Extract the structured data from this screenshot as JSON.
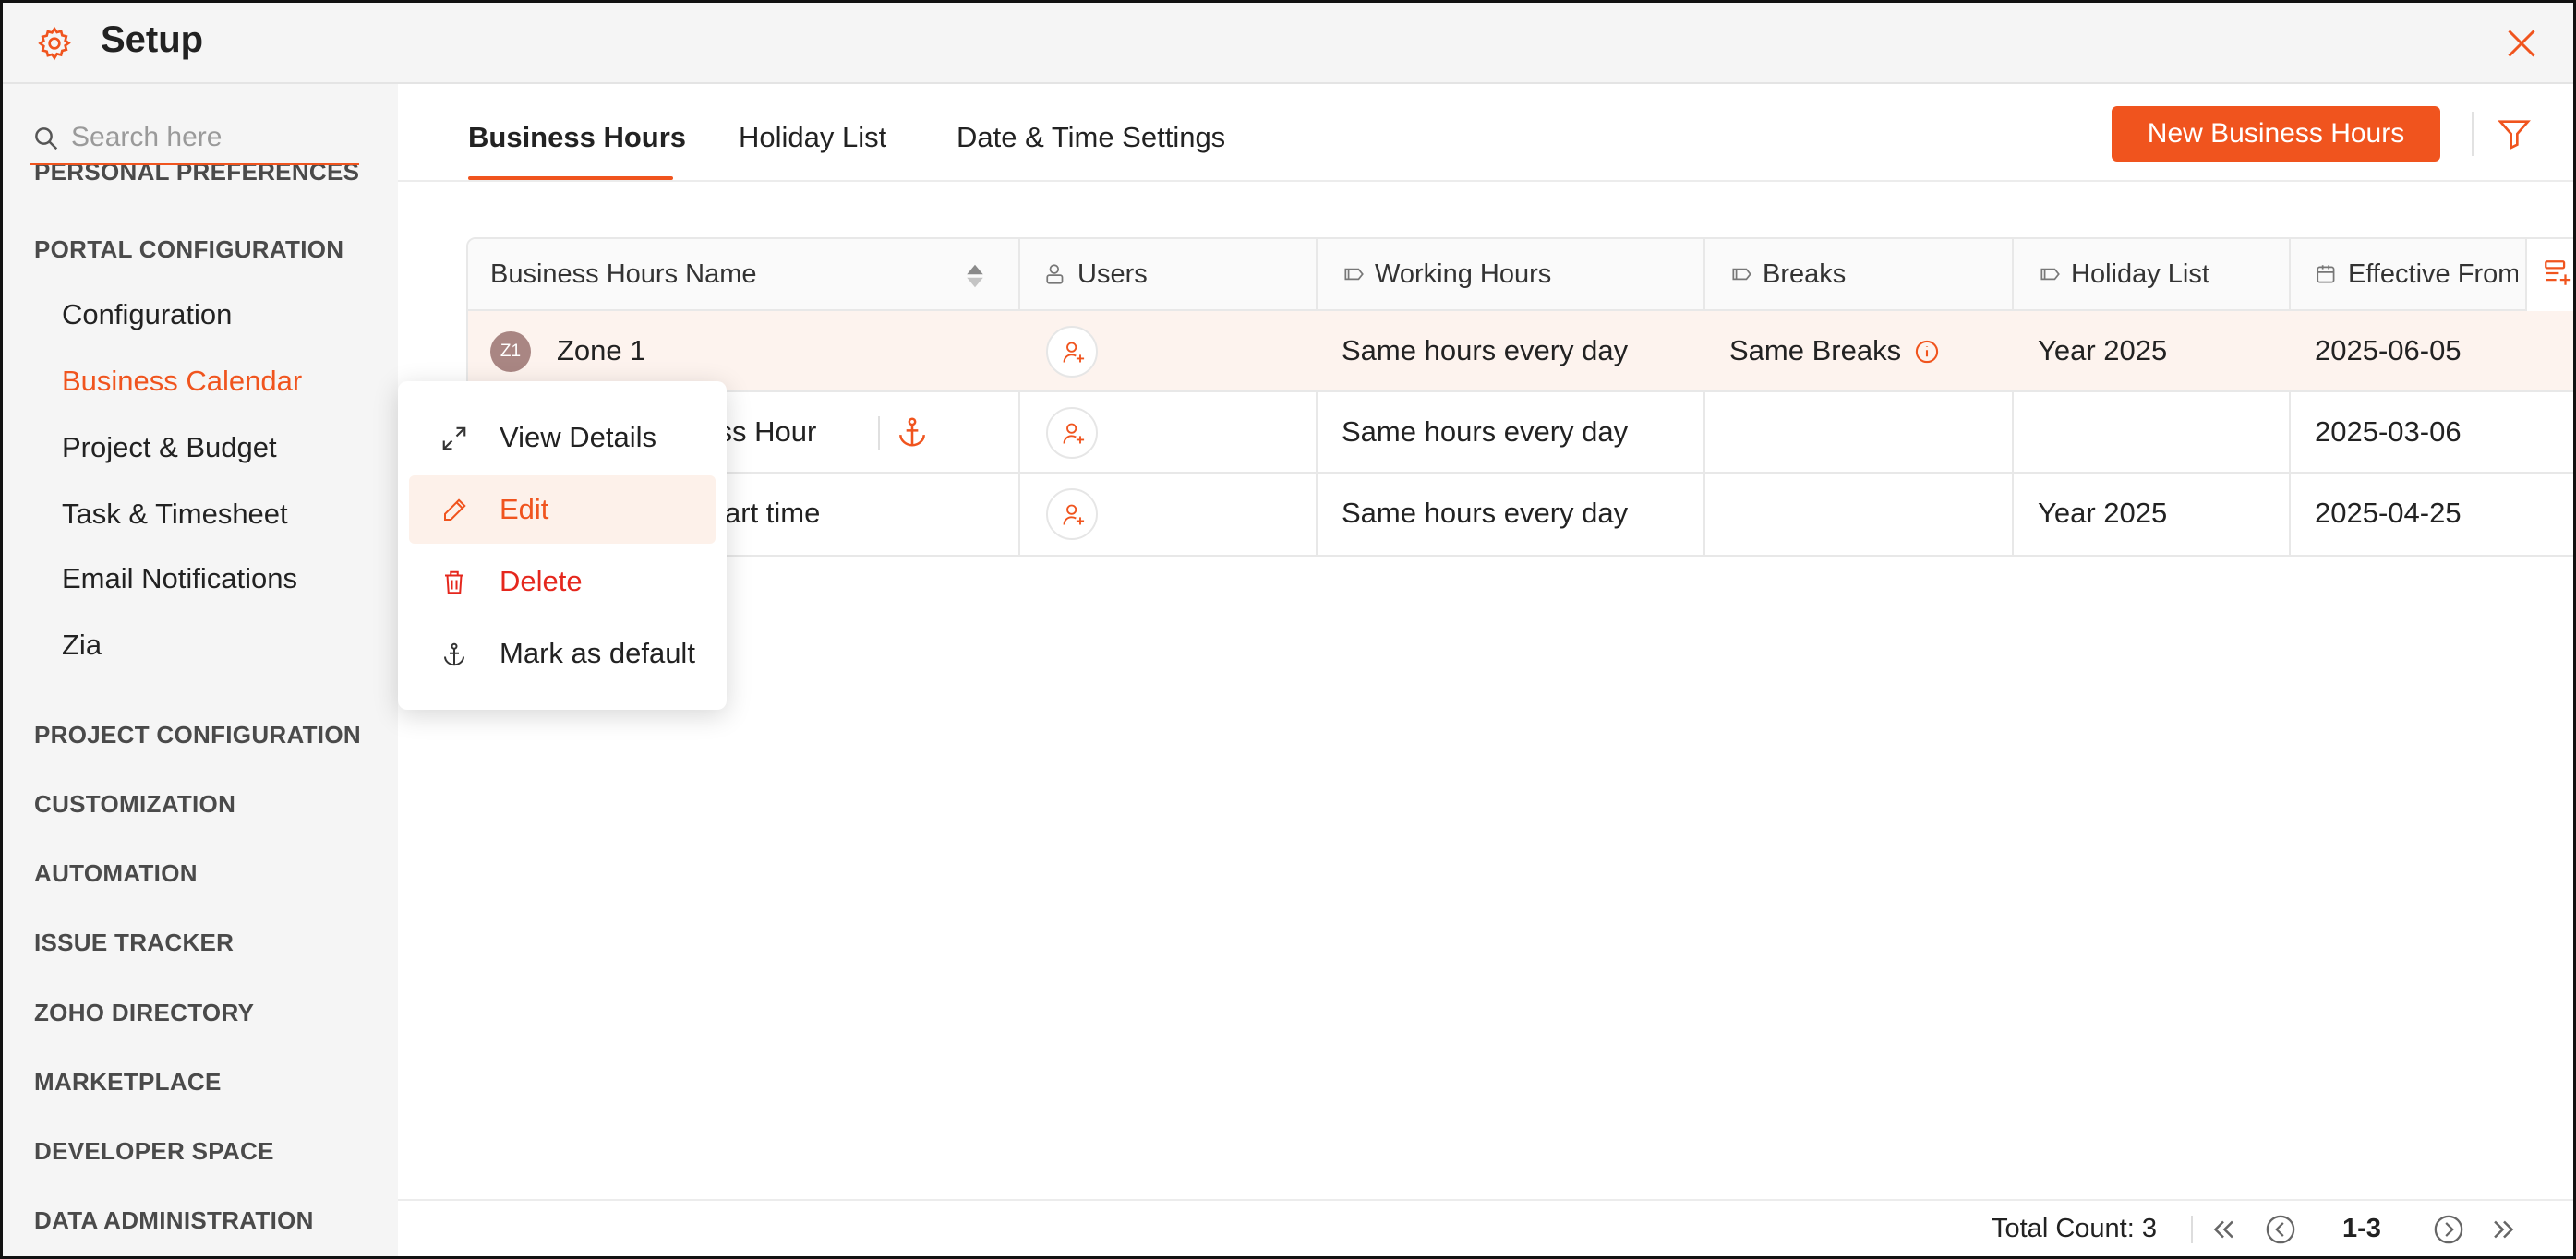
{
  "header": {
    "title": "Setup",
    "close_icon": "close-icon",
    "settings_icon": "gear-icon"
  },
  "sidebar": {
    "search_placeholder": "Search here",
    "clipped_heading": "PERSONAL PREFERENCES",
    "portal_configuration": "PORTAL CONFIGURATION",
    "items": [
      {
        "label": "Configuration"
      },
      {
        "label": "Business Calendar",
        "active": true
      },
      {
        "label": "Project & Budget"
      },
      {
        "label": "Task & Timesheet"
      },
      {
        "label": "Email Notifications"
      },
      {
        "label": "Zia"
      }
    ],
    "headings": [
      "PROJECT CONFIGURATION",
      "CUSTOMIZATION",
      "AUTOMATION",
      "ISSUE TRACKER",
      "ZOHO DIRECTORY",
      "MARKETPLACE",
      "DEVELOPER SPACE",
      "DATA ADMINISTRATION"
    ]
  },
  "tabs": [
    {
      "label": "Business Hours",
      "active": true
    },
    {
      "label": "Holiday List"
    },
    {
      "label": "Date & Time Settings"
    }
  ],
  "toolbar": {
    "new_button": "New Business Hours",
    "filter_icon": "filter-icon"
  },
  "table": {
    "columns": [
      "Business Hours Name",
      "Users",
      "Working Hours",
      "Breaks",
      "Holiday List",
      "Effective From"
    ],
    "rows": [
      {
        "avatar": "Z1",
        "name": "Zone 1",
        "working_hours": "Same hours every day",
        "breaks": "Same Breaks",
        "holiday_list": "Year 2025",
        "effective_from": "2025-06-05"
      },
      {
        "name_visible": "ness Hour",
        "working_hours": "Same hours every day",
        "breaks": "",
        "holiday_list": "",
        "effective_from": "2025-03-06"
      },
      {
        "name_visible": "art time",
        "working_hours": "Same hours every day",
        "breaks": "",
        "holiday_list": "Year 2025",
        "effective_from": "2025-04-25"
      }
    ]
  },
  "context_menu": {
    "items": [
      {
        "label": "View Details",
        "icon": "expand-icon"
      },
      {
        "label": "Edit",
        "icon": "pencil-icon"
      },
      {
        "label": "Delete",
        "icon": "trash-icon"
      },
      {
        "label": "Mark as default",
        "icon": "anchor-icon"
      }
    ]
  },
  "footer": {
    "total_count": "Total Count: 3",
    "range": "1-3"
  },
  "colors": {
    "accent": "#f0541e",
    "danger": "#e5271d",
    "row_highlight": "#fdf3ee"
  }
}
